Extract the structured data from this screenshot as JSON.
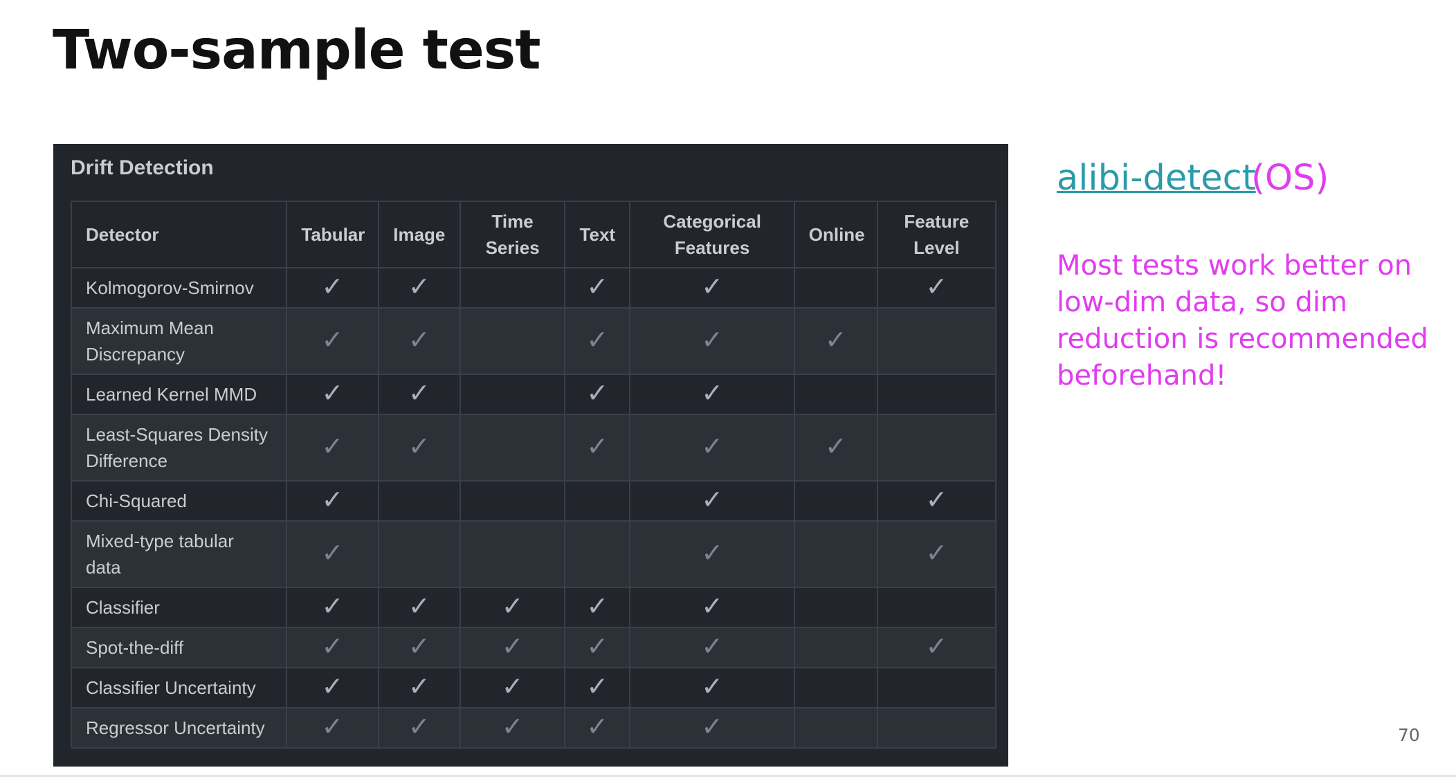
{
  "slide": {
    "title": "Two-sample test",
    "page_number": "70"
  },
  "panel": {
    "heading": "Drift Detection",
    "columns": [
      "Detector",
      "Tabular",
      "Image",
      "Time Series",
      "Text",
      "Categorical Features",
      "Online",
      "Feature Level"
    ],
    "check_glyph": "✓",
    "rows": [
      {
        "detector": "Kolmogorov-Smirnov",
        "checks": [
          true,
          true,
          false,
          true,
          true,
          false,
          true
        ]
      },
      {
        "detector": "Maximum Mean Discrepancy",
        "checks": [
          true,
          true,
          false,
          true,
          true,
          true,
          false
        ]
      },
      {
        "detector": "Learned Kernel MMD",
        "checks": [
          true,
          true,
          false,
          true,
          true,
          false,
          false
        ]
      },
      {
        "detector": "Least-Squares Density Difference",
        "checks": [
          true,
          true,
          false,
          true,
          true,
          true,
          false
        ]
      },
      {
        "detector": "Chi-Squared",
        "checks": [
          true,
          false,
          false,
          false,
          true,
          false,
          true
        ]
      },
      {
        "detector": "Mixed-type tabular data",
        "checks": [
          true,
          false,
          false,
          false,
          true,
          false,
          true
        ]
      },
      {
        "detector": "Classifier",
        "checks": [
          true,
          true,
          true,
          true,
          true,
          false,
          false
        ]
      },
      {
        "detector": "Spot-the-diff",
        "checks": [
          true,
          true,
          true,
          true,
          true,
          false,
          true
        ]
      },
      {
        "detector": "Classifier Uncertainty",
        "checks": [
          true,
          true,
          true,
          true,
          true,
          false,
          false
        ]
      },
      {
        "detector": "Regressor Uncertainty",
        "checks": [
          true,
          true,
          true,
          true,
          true,
          false,
          false
        ]
      }
    ]
  },
  "side": {
    "link_text": "alibi-detect",
    "link_suffix": "(OS)",
    "note": "Most tests work better on low-dim data, so dim reduction is recommended beforehand!"
  },
  "colors": {
    "link": "#2b9bab",
    "accent": "#e13cf0",
    "table_bg": "#22262c",
    "table_alt_row": "#2c3138",
    "table_border": "#3a4049"
  }
}
